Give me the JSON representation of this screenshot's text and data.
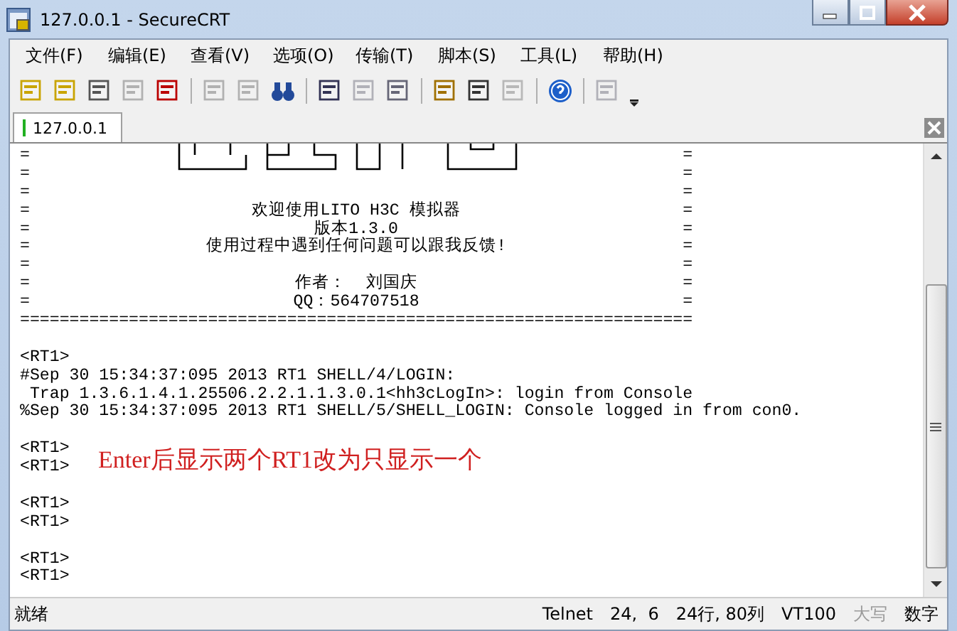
{
  "window": {
    "title": "127.0.0.1 - SecureCRT"
  },
  "menu": [
    "文件(F)",
    "编辑(E)",
    "查看(V)",
    "选项(O)",
    "传输(T)",
    "脚本(S)",
    "工具(L)",
    "帮助(H)"
  ],
  "toolbar": [
    {
      "kind": "connect",
      "disabled": false
    },
    {
      "kind": "quick",
      "disabled": false
    },
    {
      "kind": "tab",
      "disabled": false
    },
    {
      "kind": "reconnect",
      "disabled": true
    },
    {
      "kind": "disconnect",
      "disabled": false
    },
    {
      "kind": "separator"
    },
    {
      "kind": "copy",
      "disabled": true
    },
    {
      "kind": "paste",
      "disabled": true
    },
    {
      "kind": "find",
      "disabled": false
    },
    {
      "kind": "separator"
    },
    {
      "kind": "print-setup",
      "disabled": false
    },
    {
      "kind": "print-screen",
      "disabled": true
    },
    {
      "kind": "print",
      "disabled": false
    },
    {
      "kind": "separator"
    },
    {
      "kind": "options",
      "disabled": false
    },
    {
      "kind": "keymap",
      "disabled": false
    },
    {
      "kind": "key",
      "disabled": true
    },
    {
      "kind": "separator"
    },
    {
      "kind": "help",
      "disabled": false
    },
    {
      "kind": "separator"
    },
    {
      "kind": "sftp",
      "disabled": true
    }
  ],
  "tabs": [
    {
      "label": "127.0.0.1",
      "selected": true
    }
  ],
  "terminal": {
    "lines": [
      {
        "kind": "framed",
        "left": "=",
        "right": "="
      },
      {
        "kind": "framed",
        "left": "=",
        "right": "="
      },
      {
        "kind": "framed",
        "left": "=",
        "right": "="
      },
      {
        "kind": "framed",
        "left": "=",
        "text": "欢迎使用LITO H3C 模拟器",
        "right": "="
      },
      {
        "kind": "framed",
        "left": "=",
        "text": "版本1.3.0",
        "right": "="
      },
      {
        "kind": "framed",
        "left": "=",
        "text": "使用过程中遇到任何问题可以跟我反馈!",
        "right": "="
      },
      {
        "kind": "framed",
        "left": "=",
        "right": "="
      },
      {
        "kind": "framed",
        "left": "=",
        "text": "作者：  刘国庆",
        "right": "="
      },
      {
        "kind": "framed",
        "left": "=",
        "text": "QQ：564707518",
        "right": "="
      },
      {
        "kind": "plain",
        "text": "===================================================================="
      },
      {
        "kind": "blank"
      },
      {
        "kind": "plain",
        "text": "<RT1>"
      },
      {
        "kind": "plain",
        "text": "#Sep 30 15:34:37:095 2013 RT1 SHELL/4/LOGIN:"
      },
      {
        "kind": "plain",
        "text": " Trap 1.3.6.1.4.1.25506.2.2.1.1.3.0.1<hh3cLogIn>: login from Console"
      },
      {
        "kind": "plain",
        "text": "%Sep 30 15:34:37:095 2013 RT1 SHELL/5/SHELL_LOGIN: Console logged in from con0."
      },
      {
        "kind": "blank"
      },
      {
        "kind": "plain",
        "text": "<RT1>"
      },
      {
        "kind": "plain",
        "text": "<RT1>"
      },
      {
        "kind": "blank"
      },
      {
        "kind": "plain",
        "text": "<RT1>"
      },
      {
        "kind": "plain",
        "text": "<RT1>"
      },
      {
        "kind": "blank"
      },
      {
        "kind": "plain",
        "text": "<RT1>"
      },
      {
        "kind": "plain",
        "text": "<RT1>"
      }
    ],
    "annotation": "Enter后显示两个RT1改为只显示一个"
  },
  "status_bar": [
    {
      "text": "就绪",
      "active": true
    },
    {
      "text": "Telnet",
      "active": true
    },
    {
      "text": "24,  6",
      "active": true
    },
    {
      "text": "24行, 80列",
      "active": true
    },
    {
      "text": "VT100",
      "active": true
    },
    {
      "text": "大写",
      "active": false
    },
    {
      "text": "数字",
      "active": true
    }
  ]
}
